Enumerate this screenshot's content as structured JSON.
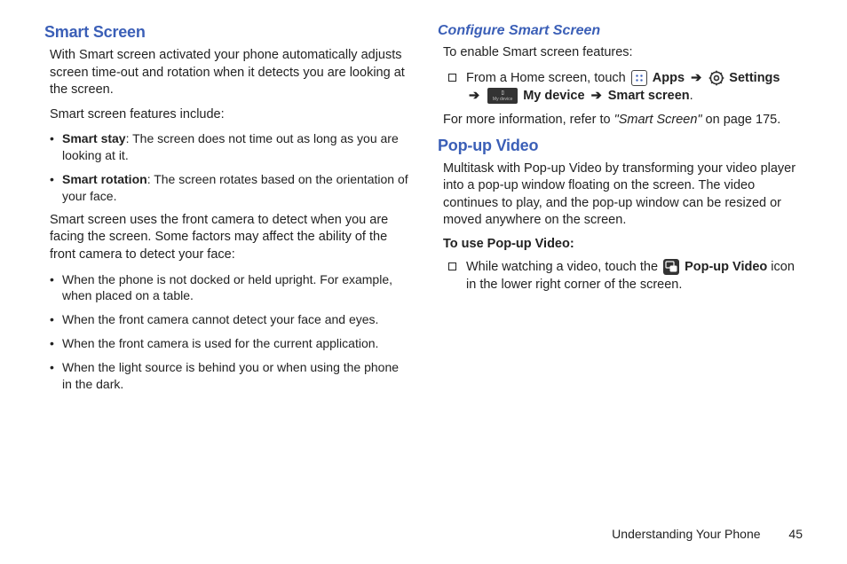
{
  "left": {
    "heading": "Smart Screen",
    "intro": "With Smart screen activated your phone automatically adjusts screen time-out and rotation when it detects you are looking at the screen.",
    "featuresLead": "Smart screen features include:",
    "feat1Label": "Smart stay",
    "feat1Text": ": The screen does not time out as long as you are looking at it.",
    "feat2Label": "Smart rotation",
    "feat2Text": ": The screen rotates based on the orientation of your face.",
    "cameraNote": "Smart screen uses the front camera to detect when you are facing the screen. Some factors may affect the ability of the front camera to detect your face:",
    "b1": "When the phone is not docked or held upright. For example, when placed on a table.",
    "b2": "When the front camera cannot detect your face and eyes.",
    "b3": "When the front camera is used for the current application.",
    "b4": "When the light source is behind you or when using the phone in the dark."
  },
  "right": {
    "configHeading": "Configure Smart Screen",
    "configLead": "To enable Smart screen features:",
    "step_prefix": "From a Home screen, touch ",
    "apps": "Apps",
    "settings": "Settings",
    "mydevice": "My device",
    "smartscreen": "Smart screen",
    "arrow": "➔",
    "moreInfo_prefix": "For more information, refer to ",
    "moreInfo_ref": "\"Smart Screen\"",
    "moreInfo_suffix": " on page 175.",
    "popupHeading": "Pop-up Video",
    "popupBody": "Multitask with Pop-up Video by transforming your video player into a pop-up window floating on the screen. The video continues to play, and the pop-up window can be resized or moved anywhere on the screen.",
    "useHeading": "To use Pop-up Video:",
    "use_prefix": "While watching a video, touch the ",
    "popupLabel": "Pop-up Video",
    "use_suffix": " icon in the lower right corner of the screen."
  },
  "footer": {
    "section": "Understanding Your Phone",
    "page": "45"
  }
}
